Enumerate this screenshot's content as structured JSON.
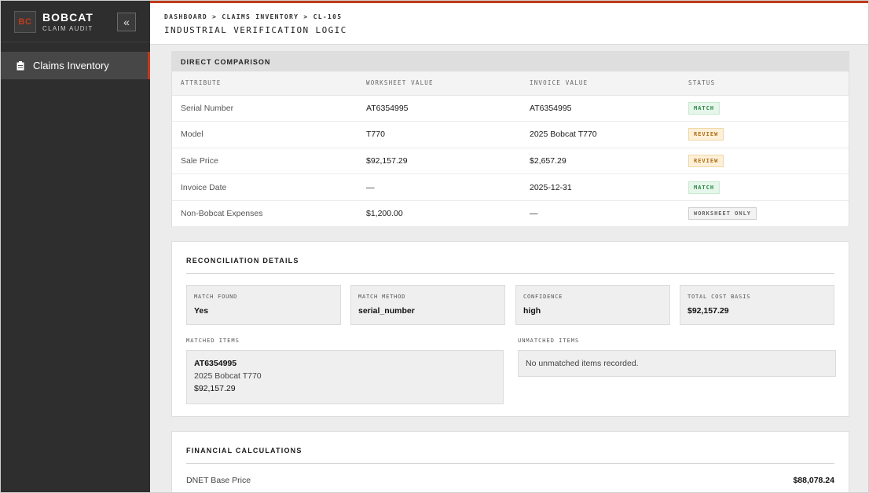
{
  "brand": {
    "logo": "BC",
    "name": "BOBCAT",
    "subtitle": "CLAIM AUDIT",
    "collapse_glyph": "«"
  },
  "sidebar": {
    "items": [
      {
        "label": "Claims Inventory",
        "icon": "clipboard-icon",
        "active": true
      }
    ]
  },
  "header": {
    "breadcrumb": "DASHBOARD > CLAIMS INVENTORY > CL-105",
    "title": "INDUSTRIAL VERIFICATION LOGIC"
  },
  "comparison": {
    "title": "DIRECT COMPARISON",
    "columns": [
      "ATTRIBUTE",
      "WORKSHEET VALUE",
      "INVOICE VALUE",
      "STATUS"
    ],
    "rows": [
      {
        "attribute": "Serial Number",
        "worksheet": "AT6354995",
        "invoice": "AT6354995",
        "status": "MATCH",
        "status_type": "match"
      },
      {
        "attribute": "Model",
        "worksheet": "T770",
        "invoice": "2025 Bobcat T770",
        "status": "REVIEW",
        "status_type": "review"
      },
      {
        "attribute": "Sale Price",
        "worksheet": "$92,157.29",
        "invoice": "$2,657.29",
        "status": "REVIEW",
        "status_type": "review"
      },
      {
        "attribute": "Invoice Date",
        "worksheet": "—",
        "invoice": "2025-12-31",
        "status": "MATCH",
        "status_type": "match"
      },
      {
        "attribute": "Non-Bobcat Expenses",
        "worksheet": "$1,200.00",
        "invoice": "—",
        "status": "WORKSHEET ONLY",
        "status_type": "ws"
      }
    ]
  },
  "reconciliation": {
    "title": "RECONCILIATION DETAILS",
    "stats": [
      {
        "label": "MATCH FOUND",
        "value": "Yes"
      },
      {
        "label": "MATCH METHOD",
        "value": "serial_number"
      },
      {
        "label": "CONFIDENCE",
        "value": "high"
      },
      {
        "label": "TOTAL COST BASIS",
        "value": "$92,157.29"
      }
    ],
    "matched_label": "MATCHED ITEMS",
    "unmatched_label": "UNMATCHED ITEMS",
    "matched_item": {
      "serial": "AT6354995",
      "model": "2025 Bobcat T770",
      "price": "$92,157.29"
    },
    "unmatched_text": "No unmatched items recorded."
  },
  "financial": {
    "title": "FINANCIAL CALCULATIONS",
    "rows": [
      {
        "label": "DNET Base Price",
        "value": "$88,078.24"
      }
    ]
  },
  "colors": {
    "accent": "#c23b1b",
    "sidebar_bg": "#2e2e2e",
    "match": "#2d8a45",
    "review": "#b06a10"
  }
}
